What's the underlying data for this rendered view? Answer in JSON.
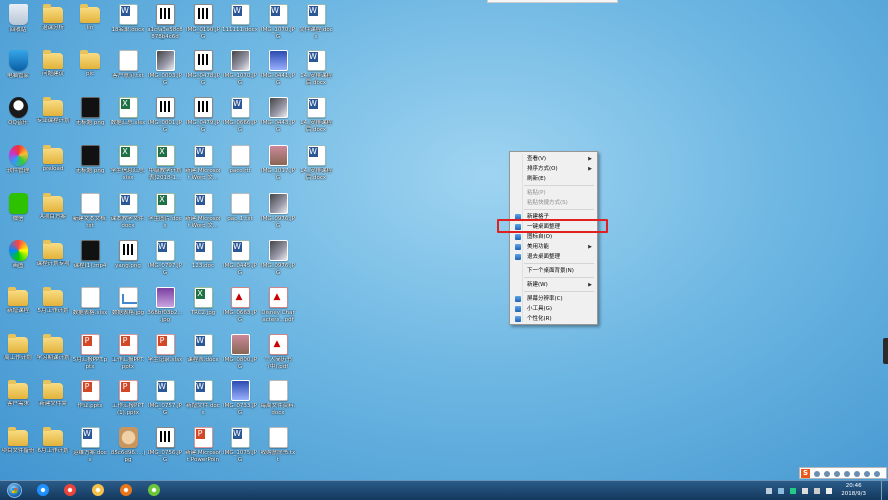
{
  "desktop": {
    "icons": [
      {
        "label": "回收站",
        "type": "recycle",
        "name": "recycle-bin-icon"
      },
      {
        "label": "退课分析",
        "type": "folder",
        "name": "folder-icon"
      },
      {
        "label": "lin",
        "type": "folder",
        "name": "folder-icon"
      },
      {
        "label": "18名单.docx",
        "type": "word",
        "name": "word-doc-icon"
      },
      {
        "label": "a1cfa3e58c8878b4c6d6...",
        "type": "qr",
        "name": "image-file-icon"
      },
      {
        "label": "IMG_0190.JPG",
        "type": "qr",
        "name": "image-file-icon"
      },
      {
        "label": "111111.docx",
        "type": "word",
        "name": "word-doc-icon"
      },
      {
        "label": "IMG_1070.JPG",
        "type": "word",
        "name": "image-file-icon"
      },
      {
        "label": "文件课程.docx",
        "type": "word",
        "name": "word-doc-icon"
      },
      {
        "label": "电脑管家",
        "type": "shield",
        "name": "pc-manager-icon"
      },
      {
        "label": "问题建议",
        "type": "folder",
        "name": "folder-icon"
      },
      {
        "label": "pic",
        "type": "folder",
        "name": "folder-icon"
      },
      {
        "label": "客户意见.txt",
        "type": "doc",
        "name": "text-file-icon"
      },
      {
        "label": "IMG_0003.JPG",
        "type": "img",
        "name": "image-file-icon"
      },
      {
        "label": "IMG_0478.JPG",
        "type": "qr",
        "name": "image-file-icon"
      },
      {
        "label": "IMG_1070.JPG",
        "type": "img",
        "name": "image-file-icon"
      },
      {
        "label": "IMG_0441.JPG",
        "type": "blue",
        "name": "image-file-icon"
      },
      {
        "label": "14_安排课程后.docx",
        "type": "word",
        "name": "word-doc-icon"
      },
      {
        "label": "QQ音乐",
        "type": "qq",
        "name": "qq-music-icon"
      },
      {
        "label": "专业课程计划",
        "type": "folder",
        "name": "folder-icon"
      },
      {
        "label": "无标题.png",
        "type": "dark",
        "name": "image-file-icon"
      },
      {
        "label": "数据汇总.xlsx",
        "type": "excel",
        "name": "excel-file-icon"
      },
      {
        "label": "IMG_0001.JPG",
        "type": "qr",
        "name": "image-file-icon"
      },
      {
        "label": "IMG_0479.JPG",
        "type": "qr",
        "name": "image-file-icon"
      },
      {
        "label": "IMG_0666.JPG",
        "type": "word",
        "name": "image-file-icon"
      },
      {
        "label": "IMG_0443.JPG",
        "type": "img",
        "name": "image-file-icon"
      },
      {
        "label": "14_安排课程后.docx",
        "type": "word",
        "name": "word-doc-icon"
      },
      {
        "label": "软件管理",
        "type": "color",
        "name": "software-manager-icon"
      },
      {
        "label": "preload",
        "type": "folder",
        "name": "folder-icon"
      },
      {
        "label": "无标题.png",
        "type": "dark",
        "name": "image-file-icon"
      },
      {
        "label": "学生信息汇总.xlsx",
        "type": "excel",
        "name": "excel-file-icon"
      },
      {
        "label": "中级教学计划表(2018-1...",
        "type": "excel",
        "name": "excel-file-icon"
      },
      {
        "label": "新建 Microsoft Word 文...",
        "type": "word",
        "name": "word-doc-icon"
      },
      {
        "label": "paco.rtf",
        "type": "doc",
        "name": "text-file-icon"
      },
      {
        "label": "IMG_1017.JPG",
        "type": "photo",
        "name": "image-file-icon"
      },
      {
        "label": "14_安排课程后.docx",
        "type": "word",
        "name": "word-doc-icon"
      },
      {
        "label": "微信",
        "type": "wechat",
        "name": "wechat-icon"
      },
      {
        "label": "A项目方案",
        "type": "folder",
        "name": "folder-icon"
      },
      {
        "label": "新建文本文档.txt",
        "type": "doc",
        "name": "text-file-icon"
      },
      {
        "label": "课本教学文件.docx",
        "type": "word",
        "name": "word-doc-icon"
      },
      {
        "label": "学生图片.docx",
        "type": "excel",
        "name": "excel-file-icon"
      },
      {
        "label": "新建 Microsoft Word 文...",
        "type": "word",
        "name": "word-doc-icon"
      },
      {
        "label": "pac_1.txt",
        "type": "doc",
        "name": "text-file-icon"
      },
      {
        "label": "IMG_0976.JPG",
        "type": "img",
        "name": "image-file-icon"
      },
      {
        "label": "画图",
        "type": "paint",
        "name": "paint-icon"
      },
      {
        "label": "课程计划专项",
        "type": "folder",
        "name": "folder-icon"
      },
      {
        "label": "课程(1).mp4",
        "type": "dark",
        "name": "video-file-icon"
      },
      {
        "label": "yang.png",
        "type": "qr",
        "name": "image-file-icon"
      },
      {
        "label": "IMG_0797.JPG",
        "type": "word",
        "name": "image-file-icon"
      },
      {
        "label": "123.doc",
        "type": "word",
        "name": "word-doc-icon"
      },
      {
        "label": "IMG_0445.JPG",
        "type": "word",
        "name": "image-file-icon"
      },
      {
        "label": "IMG_0976.JPG",
        "type": "img",
        "name": "image-file-icon"
      },
      {
        "label": "新增课程",
        "type": "folder",
        "name": "folder-icon"
      },
      {
        "label": "5月工作计划",
        "type": "folder",
        "name": "folder-icon"
      },
      {
        "label": "数据表格.xlsx",
        "type": "doc",
        "name": "text-file-icon"
      },
      {
        "label": "数据表格.jpg",
        "type": "chart",
        "name": "image-file-icon"
      },
      {
        "label": "368bf03b2... .jpg",
        "type": "purple",
        "name": "image-file-icon"
      },
      {
        "label": "TRC2.jpg",
        "type": "excel",
        "name": "excel-file-icon"
      },
      {
        "label": "IMG_0663.JPG",
        "type": "pdf",
        "name": "image-file-icon"
      },
      {
        "label": "Disney Characters...pdf",
        "type": "pdf",
        "name": "pdf-file-icon"
      },
      {
        "label": "周工作计划",
        "type": "folder",
        "name": "folder-icon"
      },
      {
        "label": "学习期课计划",
        "type": "folder",
        "name": "folder-icon"
      },
      {
        "label": "5月汇报PPT.pptx",
        "type": "ppt",
        "name": "ppt-file-icon"
      },
      {
        "label": "工作汇报PPT.pptx",
        "type": "ppt",
        "name": "ppt-file-icon"
      },
      {
        "label": "学生记录.xlsx",
        "type": "ppt",
        "name": "ppt-file-icon"
      },
      {
        "label": "课程表.docx",
        "type": "word",
        "name": "word-doc-icon"
      },
      {
        "label": "IMG_0800.JPG",
        "type": "photo",
        "name": "image-file-icon"
      },
      {
        "label": "个人简历书(中).pdf",
        "type": "pdf",
        "name": "pdf-file-icon"
      },
      {
        "label": "客户需求",
        "type": "folder",
        "name": "folder-icon"
      },
      {
        "label": "新建文件夹",
        "type": "folder",
        "name": "folder-icon"
      },
      {
        "label": "作业.pptx",
        "type": "ppt",
        "name": "ppt-file-icon"
      },
      {
        "label": "工作汇报PPT(1).pptx",
        "type": "ppt",
        "name": "ppt-file-icon"
      },
      {
        "label": "IMG_0757.JPG",
        "type": "word",
        "name": "image-file-icon"
      },
      {
        "label": "新增文件.docx",
        "type": "word",
        "name": "word-doc-icon"
      },
      {
        "label": "IMG_0733.JPG",
        "type": "blue",
        "name": "image-file-icon"
      },
      {
        "label": "每周文件资料.docx",
        "type": "doc",
        "name": "text-file-icon"
      },
      {
        "label": "项目文件备份",
        "type": "folder",
        "name": "folder-icon"
      },
      {
        "label": "6月工作计划",
        "type": "folder",
        "name": "folder-icon"
      },
      {
        "label": "运维方案.docx",
        "type": "word",
        "name": "word-doc-icon"
      },
      {
        "label": "85c6d96... .jpg",
        "type": "bear",
        "name": "image-file-icon"
      },
      {
        "label": "IMG_0756.JPG",
        "type": "qr",
        "name": "image-file-icon"
      },
      {
        "label": "新建 Microsoft PowerPoint...",
        "type": "ppt",
        "name": "ppt-file-icon"
      },
      {
        "label": "IMG_1075.JPG",
        "type": "word",
        "name": "image-file-icon"
      },
      {
        "label": "收购意向书.txt",
        "type": "doc",
        "name": "text-file-icon"
      }
    ]
  },
  "context_menu": {
    "items": [
      {
        "label": "查看(V)",
        "arrow": true,
        "disabled": false,
        "icon": false,
        "name": "menu-item-view"
      },
      {
        "label": "排序方式(O)",
        "arrow": true,
        "disabled": false,
        "icon": false,
        "name": "menu-item-sort"
      },
      {
        "label": "刷新(E)",
        "arrow": false,
        "disabled": false,
        "icon": false,
        "name": "menu-item-refresh"
      },
      {
        "label": "粘贴(P)",
        "arrow": false,
        "disabled": true,
        "icon": false,
        "name": "menu-item-paste"
      },
      {
        "label": "粘贴快捷方式(S)",
        "arrow": false,
        "disabled": true,
        "icon": false,
        "name": "menu-item-paste-shortcut"
      },
      {
        "label": "新建格子",
        "arrow": false,
        "disabled": false,
        "icon": true,
        "name": "menu-item-new-grid"
      },
      {
        "label": "一键桌面整理",
        "arrow": false,
        "disabled": false,
        "icon": true,
        "name": "menu-item-one-click-organize"
      },
      {
        "label": "图标自(O)",
        "arrow": false,
        "disabled": false,
        "icon": true,
        "name": "menu-item-icon-auto"
      },
      {
        "label": "美用功能",
        "arrow": true,
        "disabled": false,
        "icon": true,
        "name": "menu-item-features"
      },
      {
        "label": "退去桌面整理",
        "arrow": false,
        "disabled": false,
        "icon": true,
        "name": "menu-item-exit-organize"
      },
      {
        "label": "下一个桌面背景(N)",
        "arrow": false,
        "disabled": false,
        "icon": false,
        "name": "menu-item-next-background"
      },
      {
        "label": "新建(W)",
        "arrow": true,
        "disabled": false,
        "icon": false,
        "name": "menu-item-new"
      },
      {
        "label": "屏幕分辨率(C)",
        "arrow": false,
        "disabled": false,
        "icon": true,
        "name": "menu-item-resolution"
      },
      {
        "label": "小工具(G)",
        "arrow": false,
        "disabled": false,
        "icon": true,
        "name": "menu-item-gadgets"
      },
      {
        "label": "个性化(R)",
        "arrow": false,
        "disabled": false,
        "icon": true,
        "name": "menu-item-personalize"
      }
    ]
  },
  "taskbar": {
    "pinned": [
      {
        "name": "ie-taskbar-icon",
        "color": "#1e90ff"
      },
      {
        "name": "chrome-taskbar-icon",
        "color": "#e8453c"
      },
      {
        "name": "explorer-taskbar-icon",
        "color": "#f3c14b"
      },
      {
        "name": "firefox-taskbar-icon",
        "color": "#e8751a"
      },
      {
        "name": "qq-browser-taskbar-icon",
        "color": "#6cc63c"
      }
    ],
    "clock_time": "20:46",
    "clock_date": "2018/9/3",
    "ime_label": "S",
    "highlight_color": "#e0211f"
  }
}
